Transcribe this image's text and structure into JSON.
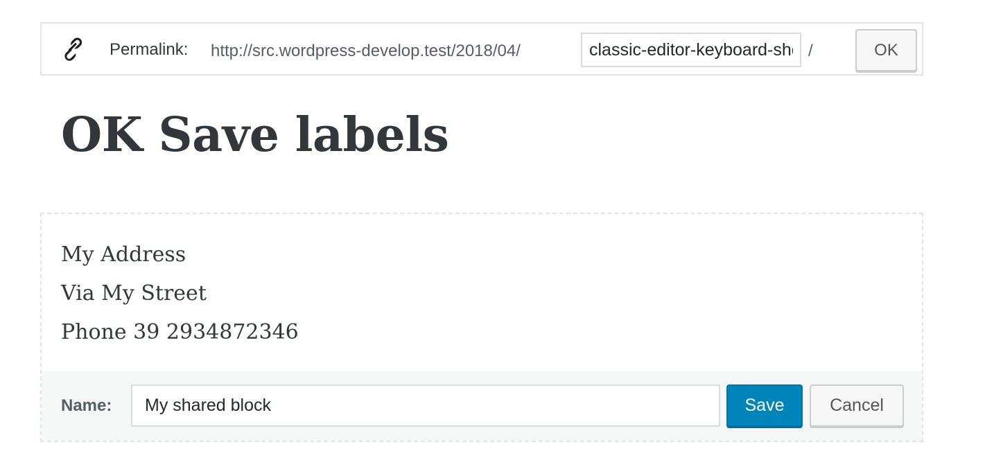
{
  "permalink": {
    "icon": "link-icon",
    "label": "Permalink:",
    "url_prefix": "http://src.wordpress-develop.test/2018/04/",
    "slug_value": "classic-editor-keyboard-shortcuts",
    "suffix": "/",
    "ok_label": "OK"
  },
  "post": {
    "title": "OK Save labels"
  },
  "shared_block": {
    "lines": [
      "My Address",
      "Via My Street",
      "Phone 39 2934872346"
    ],
    "name_label": "Name:",
    "name_value": "My shared block",
    "save_label": "Save",
    "cancel_label": "Cancel"
  },
  "colors": {
    "primary_button": "#0085ba",
    "text": "#32373c",
    "border": "#e2e4e7"
  }
}
